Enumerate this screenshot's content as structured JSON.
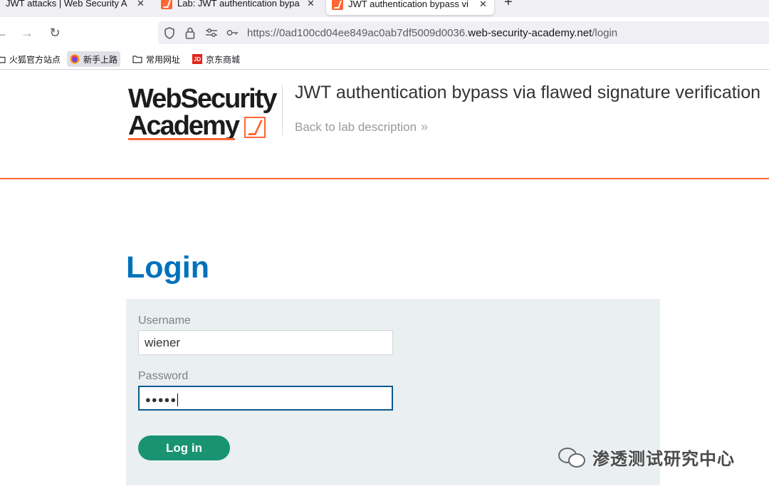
{
  "browser": {
    "tabs": [
      {
        "title": "JWT attacks | Web Security A",
        "active": false
      },
      {
        "title": "Lab: JWT authentication bypa",
        "active": false
      },
      {
        "title": "JWT authentication bypass vi",
        "active": true
      }
    ],
    "new_tab_glyph": "+",
    "url": {
      "prefix": "https://0ad100cd04ee849ac0ab7df5009d0036.",
      "host": "web-security-academy.net",
      "path": "/login"
    },
    "bookmarks": [
      {
        "label": "火狐官方站点",
        "icon": "folder-icon"
      },
      {
        "label": "新手上路",
        "icon": "firefox-icon"
      },
      {
        "label": "常用网址",
        "icon": "folder-icon"
      },
      {
        "label": "京东商城",
        "icon": "jd-icon"
      }
    ],
    "jd_badge": "JD"
  },
  "site": {
    "logo_line1": "WebSecurity",
    "logo_line2": "Academy",
    "lab_title": "JWT authentication bypass via flawed signature verification",
    "back_link": "Back to lab description",
    "back_chevrons": "»",
    "accent_color": "#ff6633"
  },
  "login": {
    "heading": "Login",
    "username_label": "Username",
    "username_value": "wiener",
    "password_label": "Password",
    "password_masked": "●●●●●",
    "button_label": "Log in",
    "button_color": "#199473",
    "heading_color": "#0071bc"
  },
  "watermark": {
    "text": "渗透测试研究中心",
    "icon": "wechat-icon"
  }
}
